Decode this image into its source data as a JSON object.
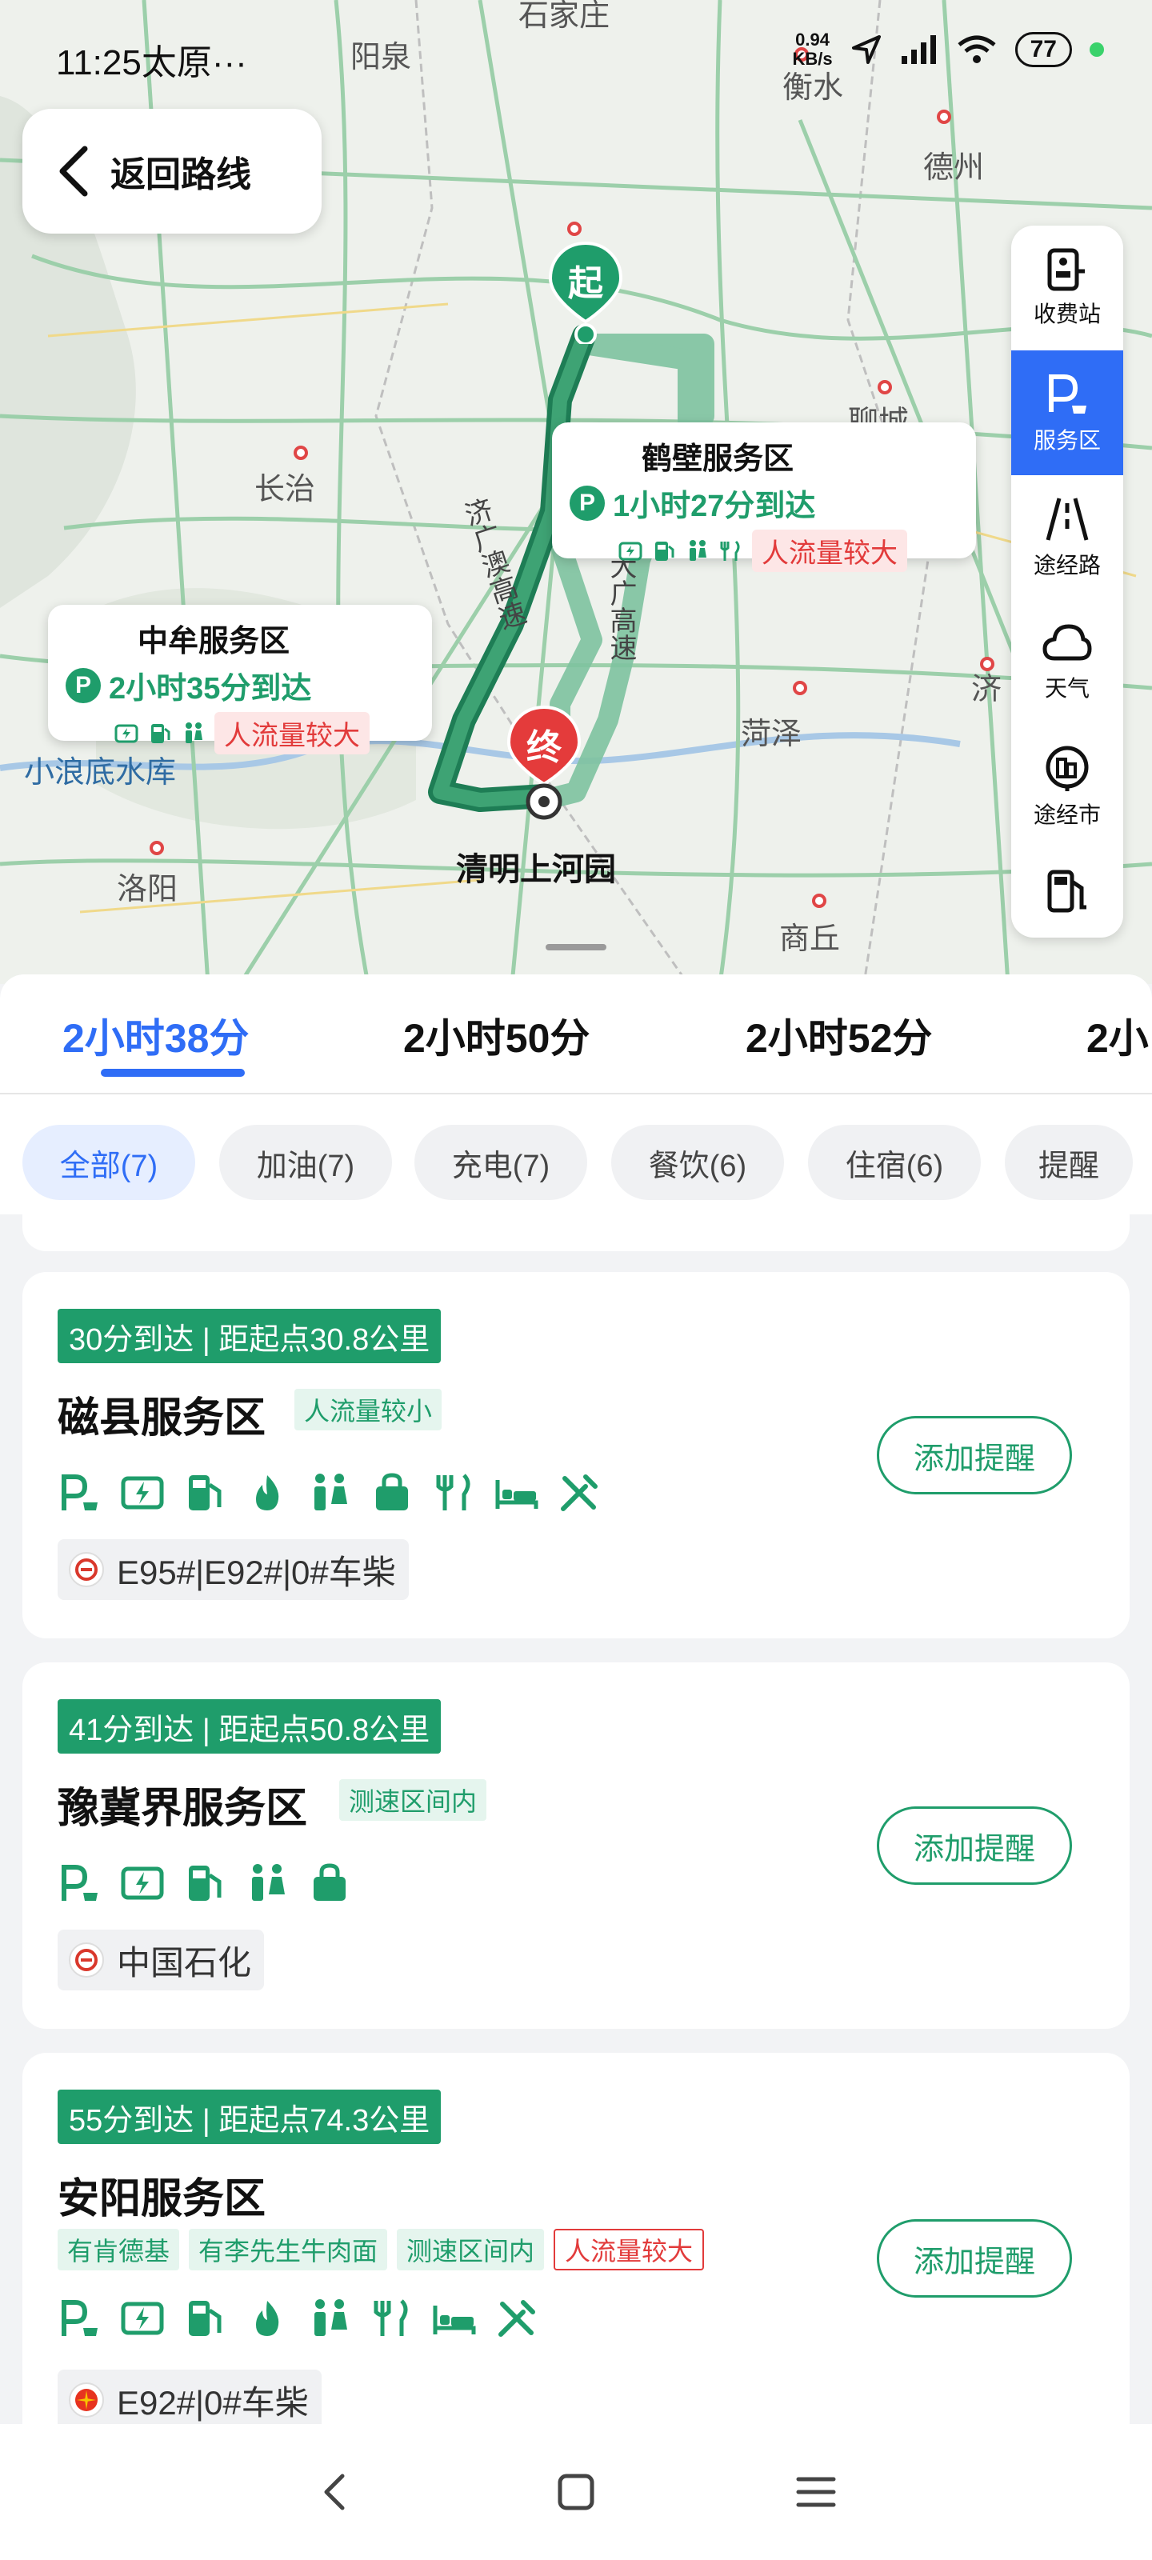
{
  "status_bar": {
    "time": "11:25",
    "carrier_fragment": "太原",
    "more": "···",
    "net_speed_value": "0.94",
    "net_speed_unit": "KB/s",
    "battery": "77"
  },
  "map": {
    "back_label": "返回路线",
    "places": {
      "shijiazhuang": "石家庄",
      "yangquan": "阳泉",
      "hengshui": "衡水",
      "dezhou": "德州",
      "changzhi": "长治",
      "liaocheng": "聊城",
      "jinan_fragment": "济",
      "heze": "菏泽",
      "luoyang": "洛阳",
      "xiaolangdi": "小浪底水库",
      "shangqiu": "商丘",
      "destination": "清明上河园"
    },
    "highway_labels": {
      "daguang": "大广高速",
      "erguang": "济广澳高速"
    },
    "start_pin": "起",
    "end_pin": "终",
    "bubbles": [
      {
        "name": "鹤壁服务区",
        "eta": "1小时27分到达",
        "p": "P",
        "crowd": "人流量较大"
      },
      {
        "name": "中牟服务区",
        "eta": "2小时35分到达",
        "p": "P",
        "crowd": "人流量较大"
      }
    ],
    "right_panel": [
      {
        "label": "收费站",
        "icon": "toll-station-icon"
      },
      {
        "label": "服务区",
        "icon": "service-area-icon",
        "active": true
      },
      {
        "label": "途经路",
        "icon": "road-icon"
      },
      {
        "label": "天气",
        "icon": "cloud-icon"
      },
      {
        "label": "途经市",
        "icon": "city-icon"
      },
      {
        "label": "",
        "icon": "gas-station-icon"
      }
    ]
  },
  "route_tabs": [
    "2小时38分",
    "2小时50分",
    "2小时52分",
    "2小"
  ],
  "filters": [
    "全部(7)",
    "加油(7)",
    "充电(7)",
    "餐饮(6)",
    "住宿(6)",
    "提醒"
  ],
  "cards": [
    {
      "eta": "30分到达 | 距起点30.8公里",
      "name": "磁县服务区",
      "tags": [
        "人流量较小"
      ],
      "facilities": [
        "parking-icon",
        "charging-icon",
        "fuel-icon",
        "gas-flame-icon",
        "restroom-icon",
        "shop-icon",
        "dining-icon",
        "lodging-icon",
        "repair-icon"
      ],
      "fuel_logo": "sinopec-logo",
      "fuel": "E95#|E92#|0#车柴",
      "button": "添加提醒"
    },
    {
      "eta": "41分到达 | 距起点50.8公里",
      "name": "豫冀界服务区",
      "tags": [
        "测速区间内"
      ],
      "facilities": [
        "parking-icon",
        "charging-icon",
        "fuel-icon",
        "restroom-icon",
        "shop-icon"
      ],
      "fuel_logo": "sinopec-logo",
      "fuel": "中国石化",
      "button": "添加提醒"
    },
    {
      "eta": "55分到达 | 距起点74.3公里",
      "name": "安阳服务区",
      "tags": [
        "有肯德基",
        "有李先生牛肉面",
        "测速区间内",
        "人流量较大"
      ],
      "facilities": [
        "parking-icon",
        "charging-icon",
        "fuel-icon",
        "gas-flame-icon",
        "restroom-icon",
        "dining-icon",
        "lodging-icon",
        "repair-icon"
      ],
      "fuel_logo": "petrochina-logo",
      "fuel": "E92#|0#车柴",
      "button": "添加提醒"
    }
  ],
  "colors": {
    "accent_blue": "#2f6df6",
    "route_green": "#1f9d6b",
    "crowd_red": "#e23b3b"
  }
}
